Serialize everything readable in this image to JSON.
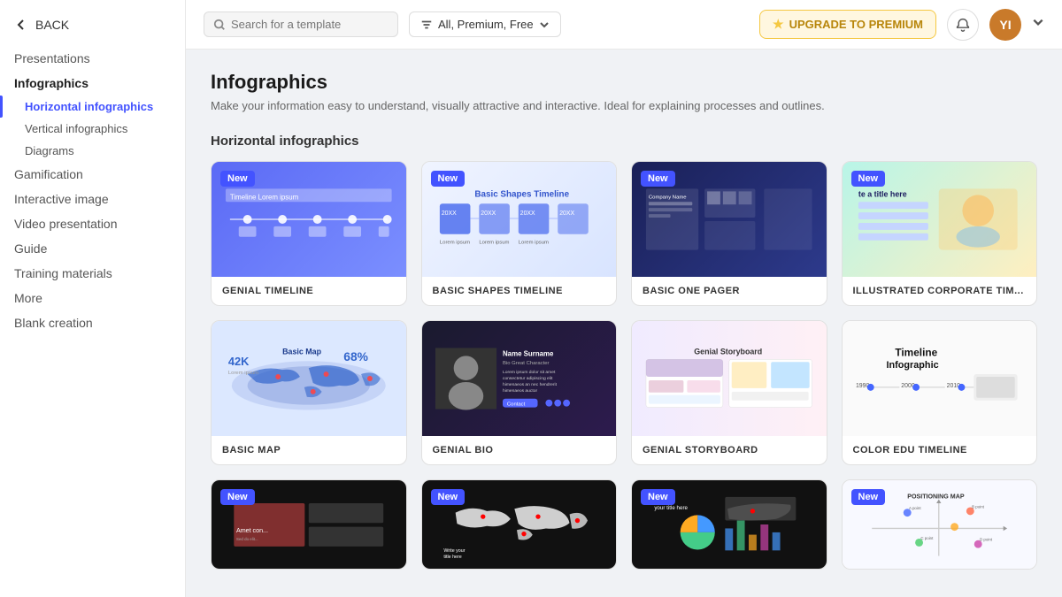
{
  "sidebar": {
    "back_label": "BACK",
    "items": [
      {
        "id": "presentations",
        "label": "Presentations",
        "level": 1,
        "active": false
      },
      {
        "id": "infographics",
        "label": "Infographics",
        "level": 1,
        "active": true
      },
      {
        "id": "horizontal-infographics",
        "label": "Horizontal infographics",
        "level": 2,
        "active": true
      },
      {
        "id": "vertical-infographics",
        "label": "Vertical infographics",
        "level": 2,
        "active": false
      },
      {
        "id": "diagrams",
        "label": "Diagrams",
        "level": 2,
        "active": false
      },
      {
        "id": "gamification",
        "label": "Gamification",
        "level": 1,
        "active": false
      },
      {
        "id": "interactive-image",
        "label": "Interactive image",
        "level": 1,
        "active": false
      },
      {
        "id": "video-presentation",
        "label": "Video presentation",
        "level": 1,
        "active": false
      },
      {
        "id": "guide",
        "label": "Guide",
        "level": 1,
        "active": false
      },
      {
        "id": "training-materials",
        "label": "Training materials",
        "level": 1,
        "active": false
      },
      {
        "id": "more",
        "label": "More",
        "level": 1,
        "active": false
      },
      {
        "id": "blank-creation",
        "label": "Blank creation",
        "level": 1,
        "active": false
      }
    ]
  },
  "topbar": {
    "search_placeholder": "Search for a template",
    "filter_label": "All, Premium, Free",
    "upgrade_label": "UPGRADE TO PREMIUM",
    "avatar_initials": "YI"
  },
  "page": {
    "title": "Infographics",
    "description": "Make your information easy to understand, visually attractive and interactive. Ideal for explaining processes and outlines.",
    "section_title": "Horizontal infographics"
  },
  "templates": {
    "row1": [
      {
        "id": "genial-timeline",
        "label": "GENIAL TIMELINE",
        "new": true,
        "preview_type": "genial-timeline"
      },
      {
        "id": "basic-shapes-timeline",
        "label": "BASIC SHAPES TIMELINE",
        "new": true,
        "preview_type": "basic-shapes"
      },
      {
        "id": "basic-one-pager",
        "label": "BASIC ONE PAGER",
        "new": true,
        "preview_type": "basic-one-pager"
      },
      {
        "id": "illustrated-corporate",
        "label": "ILLUSTRATED CORPORATE TIM...",
        "new": true,
        "preview_type": "illustrated"
      }
    ],
    "row2": [
      {
        "id": "basic-map",
        "label": "BASIC MAP",
        "new": false,
        "preview_type": "basic-map"
      },
      {
        "id": "genial-bio",
        "label": "GENIAL BIO",
        "new": false,
        "preview_type": "genial-bio"
      },
      {
        "id": "genial-storyboard",
        "label": "GENIAL STORYBOARD",
        "new": false,
        "preview_type": "genial-storyboard"
      },
      {
        "id": "color-edu-timeline",
        "label": "COLOR EDU TIMELINE",
        "new": false,
        "preview_type": "color-edu"
      }
    ],
    "row3": [
      {
        "id": "dark-template-1",
        "label": "",
        "new": true,
        "preview_type": "dark1"
      },
      {
        "id": "dark-template-2",
        "label": "",
        "new": true,
        "preview_type": "dark2"
      },
      {
        "id": "dark-template-3",
        "label": "",
        "new": true,
        "preview_type": "dark3"
      },
      {
        "id": "pos-map",
        "label": "",
        "new": true,
        "preview_type": "pos-map"
      }
    ]
  }
}
